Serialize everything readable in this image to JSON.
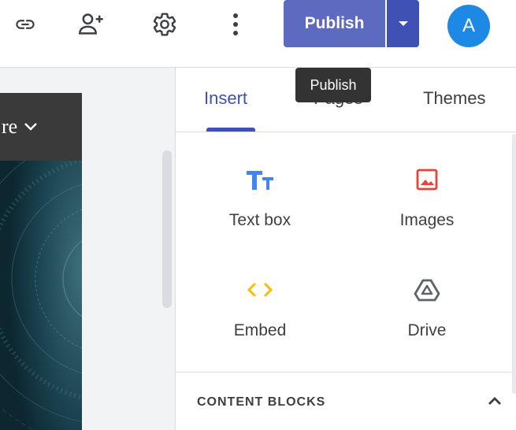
{
  "toolbar": {
    "icons": [
      "link-icon",
      "add-person-icon",
      "gear-icon",
      "more-vert-icon"
    ],
    "publish_label": "Publish",
    "avatar_initial": "A",
    "colors": {
      "publish": "#5c6bc0",
      "publish_arrow": "#3f51b5",
      "avatar": "#1e88e5"
    }
  },
  "canvas": {
    "nav_label": "re"
  },
  "tooltip": {
    "text": "Publish"
  },
  "panel": {
    "tabs": [
      {
        "label": "Insert",
        "active": true
      },
      {
        "label": "Pages",
        "active": false
      },
      {
        "label": "Themes",
        "active": false
      }
    ],
    "items": [
      {
        "label": "Text box",
        "icon": "text-box-icon",
        "color": "#4285f4"
      },
      {
        "label": "Images",
        "icon": "image-icon",
        "color": "#ea4335"
      },
      {
        "label": "Embed",
        "icon": "embed-icon",
        "color": "#fbbc04"
      },
      {
        "label": "Drive",
        "icon": "drive-icon",
        "color": "#5f6368"
      }
    ],
    "section_title": "CONTENT BLOCKS"
  }
}
